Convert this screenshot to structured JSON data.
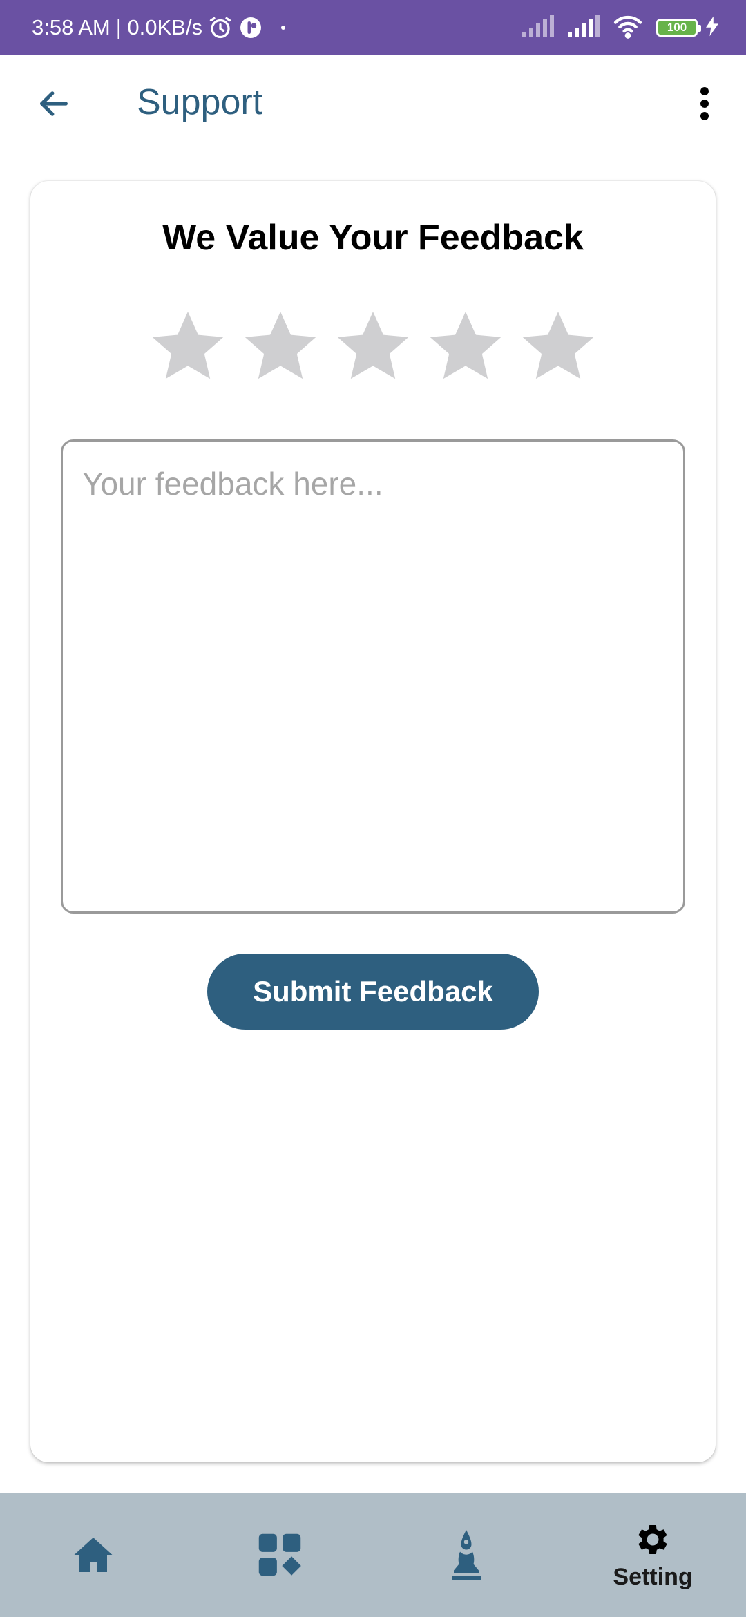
{
  "status_bar": {
    "time": "3:58 AM",
    "network_speed": "| 0.0KB/s",
    "battery_level": "100",
    "icons": [
      "alarm-icon",
      "app-notification-icon",
      "dot-icon",
      "signal-icon",
      "signal-icon",
      "wifi-icon",
      "battery-icon",
      "charging-icon"
    ]
  },
  "app_bar": {
    "title": "Support",
    "back_icon": "arrow-left-icon",
    "menu_icon": "more-vertical-icon"
  },
  "feedback": {
    "title": "We Value Your Feedback",
    "rating": {
      "value": 0,
      "max": 5
    },
    "placeholder": "Your feedback here...",
    "value": "",
    "submit_label": "Submit Feedback"
  },
  "bottom_nav": {
    "items": [
      {
        "id": "home",
        "icon": "home-icon",
        "label": ""
      },
      {
        "id": "dashboard",
        "icon": "dashboard-icon",
        "label": ""
      },
      {
        "id": "yoga",
        "icon": "meditation-icon",
        "label": ""
      },
      {
        "id": "setting",
        "icon": "gear-icon",
        "label": "Setting"
      }
    ],
    "active": "setting"
  },
  "colors": {
    "status_bar_bg": "#6a51a3",
    "primary": "#2e5f7f",
    "star_inactive": "#cfcfd1",
    "bottom_nav_bg": "#b0bec7",
    "placeholder": "#a6a6a6"
  }
}
